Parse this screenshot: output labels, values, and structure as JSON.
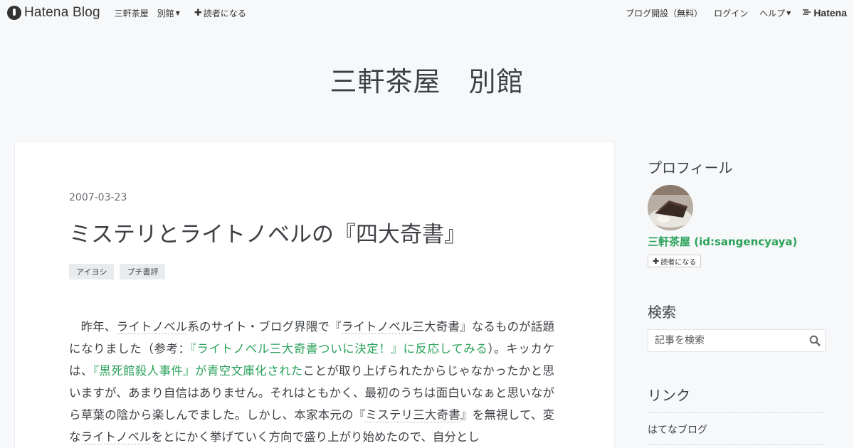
{
  "global_header": {
    "logo_text": "Hatena Blog",
    "blog_name_menu": "三軒茶屋　別館",
    "subscribe": "読者になる",
    "start_blog": "ブログ開設（無料）",
    "login": "ログイン",
    "help": "ヘルプ",
    "hatena_logo": "Hatena"
  },
  "blog": {
    "title": "三軒茶屋　別館"
  },
  "entry": {
    "date": "2007-03-23",
    "title": "ミステリとライトノベルの『四大奇書』",
    "categories": [
      "アイヨシ",
      "プチ書評"
    ],
    "body": {
      "p1": "　昨年、",
      "kw1": "ライトノベル",
      "p2": "系のサイト・ブログ界隈で『",
      "kw2": "ライトノベル",
      "p3": "三大奇書』なるものが話題になりました（参考：",
      "link1": "『ライトノベル三大奇書ついに決定！』に反応してみる",
      "p4": "）。キッカケは、",
      "link2": "『黒死館殺人事件』が青空文庫化された",
      "p5": "ことが取り上げられたからじゃなかったかと思いますが、あまり自信はありません。それはともかく、最初のうちは面白いなぁと思いながら草葉の陰から楽しんでました。しかし、本家本元の『",
      "kw3": "ミステリ三大奇書",
      "p6": "』を無視して、変な",
      "kw4": "ライトノベル",
      "p7": "をとにかく挙げていく方向で盛り上がり始めたので、自分とし"
    }
  },
  "sidebar": {
    "profile_heading": "プロフィール",
    "profile_name": "三軒茶屋 (id:sangencyaya)",
    "subscribe_button": "読者になる",
    "search_heading": "検索",
    "search_placeholder": "記事を検索",
    "links_heading": "リンク",
    "links": [
      "はてなブログ"
    ]
  },
  "colors": {
    "link_green": "#2ba15a",
    "background": "#f7f8fa",
    "text": "#3d3f44"
  },
  "icons": [
    "hatena-blog-logo-icon",
    "caret-down-icon",
    "plus-icon",
    "search-icon",
    "hatena-logo-icon"
  ]
}
